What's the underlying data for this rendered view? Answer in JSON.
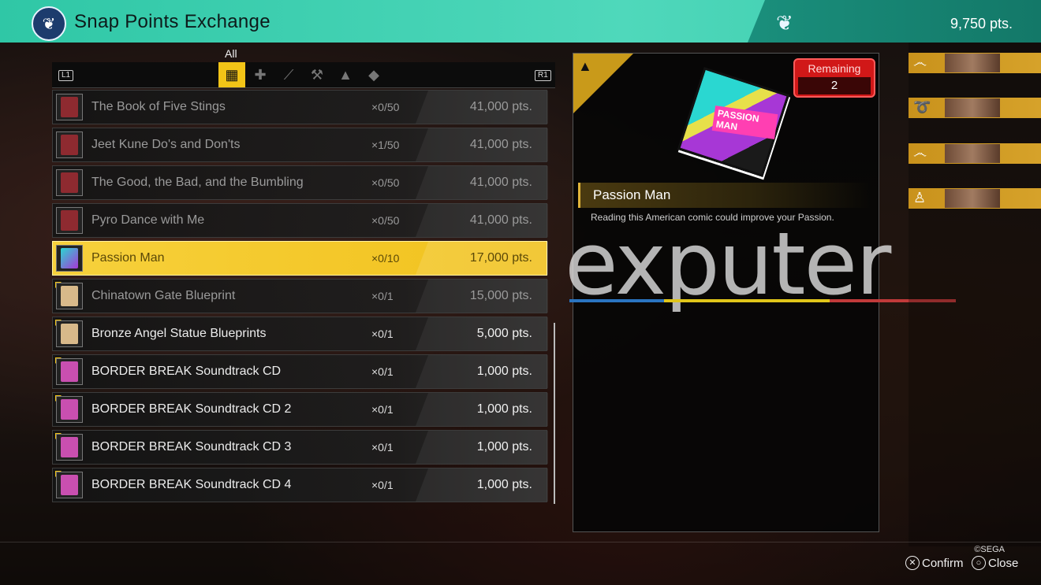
{
  "header": {
    "title": "Snap Points Exchange",
    "points": "9,750 pts.",
    "logo_icon": "butterfly-icon"
  },
  "tabs": {
    "active_label": "All",
    "left_button": "L1",
    "right_button": "R1",
    "items": [
      "grid-icon",
      "medicine-plus-icon",
      "knife-icon",
      "hammer-icon",
      "stacked-bottles-icon",
      "diamond-icon"
    ]
  },
  "items": [
    {
      "name": "The Book of Five Stings",
      "qty": "×0/50",
      "price": "41,000 pts."
    },
    {
      "name": "Jeet Kune Do's and Don'ts",
      "qty": "×1/50",
      "price": "41,000 pts."
    },
    {
      "name": "The Good, the Bad, and the Bumbling",
      "qty": "×0/50",
      "price": "41,000 pts."
    },
    {
      "name": "Pyro Dance with Me",
      "qty": "×0/50",
      "price": "41,000 pts."
    },
    {
      "name": "Passion Man",
      "qty": "×0/10",
      "price": "17,000 pts."
    },
    {
      "name": "Chinatown Gate Blueprint",
      "qty": "×0/1",
      "price": "15,000 pts."
    },
    {
      "name": "Bronze Angel Statue Blueprints",
      "qty": "×0/1",
      "price": "5,000 pts."
    },
    {
      "name": "BORDER BREAK Soundtrack CD",
      "qty": "×0/1",
      "price": "1,000 pts."
    },
    {
      "name": "BORDER BREAK Soundtrack CD 2",
      "qty": "×0/1",
      "price": "1,000 pts."
    },
    {
      "name": "BORDER BREAK Soundtrack CD 3",
      "qty": "×0/1",
      "price": "1,000 pts."
    },
    {
      "name": "BORDER BREAK Soundtrack CD 4",
      "qty": "×0/1",
      "price": "1,000 pts."
    }
  ],
  "detail": {
    "remaining_label": "Remaining",
    "remaining_value": "2",
    "name": "Passion Man",
    "description": "Reading this American comic could improve your Passion.",
    "comic_text": "PASSION MAN"
  },
  "watermark": "exputer",
  "footer": {
    "copyright": "©SEGA",
    "confirm": "Confirm",
    "close": "Close"
  },
  "colors": {
    "accent_teal": "#3fd2b3",
    "selected_yellow": "#f2c417",
    "remaining_red": "#d11818"
  }
}
